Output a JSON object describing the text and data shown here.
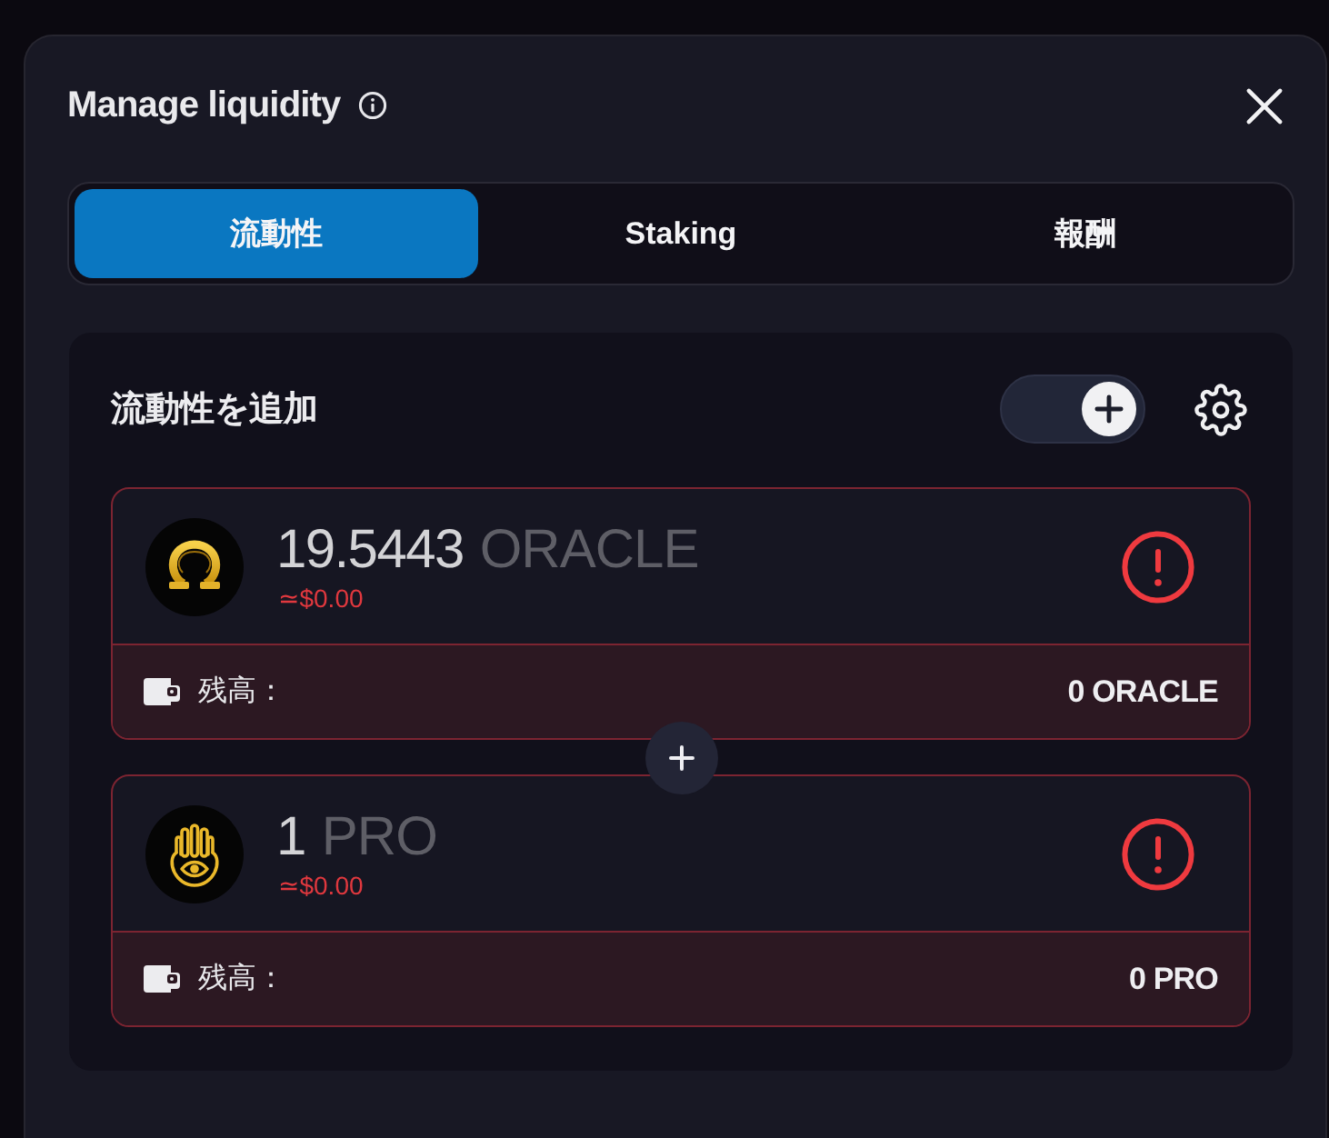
{
  "dialog": {
    "title": "Manage liquidity",
    "tabs": [
      {
        "label": "流動性",
        "selected": true
      },
      {
        "label": "Staking",
        "selected": false
      },
      {
        "label": "報酬",
        "selected": false
      }
    ]
  },
  "add_liquidity": {
    "title": "流動性を追加",
    "toggle": {
      "on": true
    },
    "tokens": [
      {
        "kind": "omega",
        "amount": "19.5443",
        "symbol": "ORACLE",
        "usd_value": "≃$0.00",
        "error": true,
        "balance_label": "残高：",
        "balance": "0 ORACLE"
      },
      {
        "kind": "hand",
        "amount": "1",
        "symbol": "PRO",
        "usd_value": "≃$0.00",
        "error": true,
        "balance_label": "残高：",
        "balance": "0 PRO"
      }
    ]
  }
}
